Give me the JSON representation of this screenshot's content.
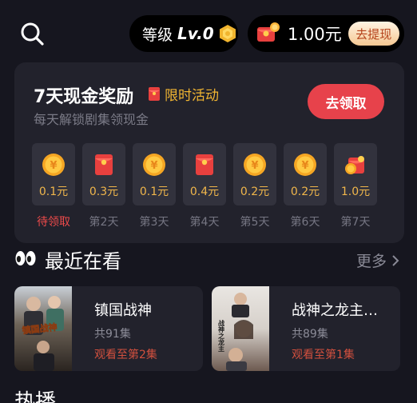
{
  "header": {
    "level_label": "等级",
    "level_value": "Lv.0",
    "cash_amount": "1.00元",
    "withdraw_label": "去提现"
  },
  "reward": {
    "title": "7天现金奖励",
    "promo_tag": "限时活动",
    "subtitle": "每天解锁剧集领现金",
    "claim_label": "去领取",
    "days": [
      {
        "icon": "coin-icon",
        "amount": "0.1元",
        "label": "待领取",
        "active": true
      },
      {
        "icon": "red-envelope-icon",
        "amount": "0.3元",
        "label": "第2天",
        "active": false
      },
      {
        "icon": "coin-icon",
        "amount": "0.1元",
        "label": "第3天",
        "active": false
      },
      {
        "icon": "red-envelope-icon",
        "amount": "0.4元",
        "label": "第4天",
        "active": false
      },
      {
        "icon": "coin-icon",
        "amount": "0.2元",
        "label": "第5天",
        "active": false
      },
      {
        "icon": "coin-icon",
        "amount": "0.2元",
        "label": "第6天",
        "active": false
      },
      {
        "icon": "gift-envelope-icon",
        "amount": "1.0元",
        "label": "第7天",
        "active": false
      }
    ]
  },
  "recent": {
    "title": "最近在看",
    "more_label": "更多",
    "items": [
      {
        "title": "镇国战神",
        "episodes": "共91集",
        "progress": "观看至第2集",
        "poster_text": "镇国战神"
      },
      {
        "title": "战神之龙主…",
        "episodes": "共89集",
        "progress": "观看至第1集",
        "poster_text": "战神之龙主"
      }
    ]
  },
  "bottom_partial": "热播",
  "colors": {
    "background": "#16161f",
    "card": "#22222c",
    "accent_red": "#e7424b",
    "accent_gold": "#f0b64b"
  }
}
